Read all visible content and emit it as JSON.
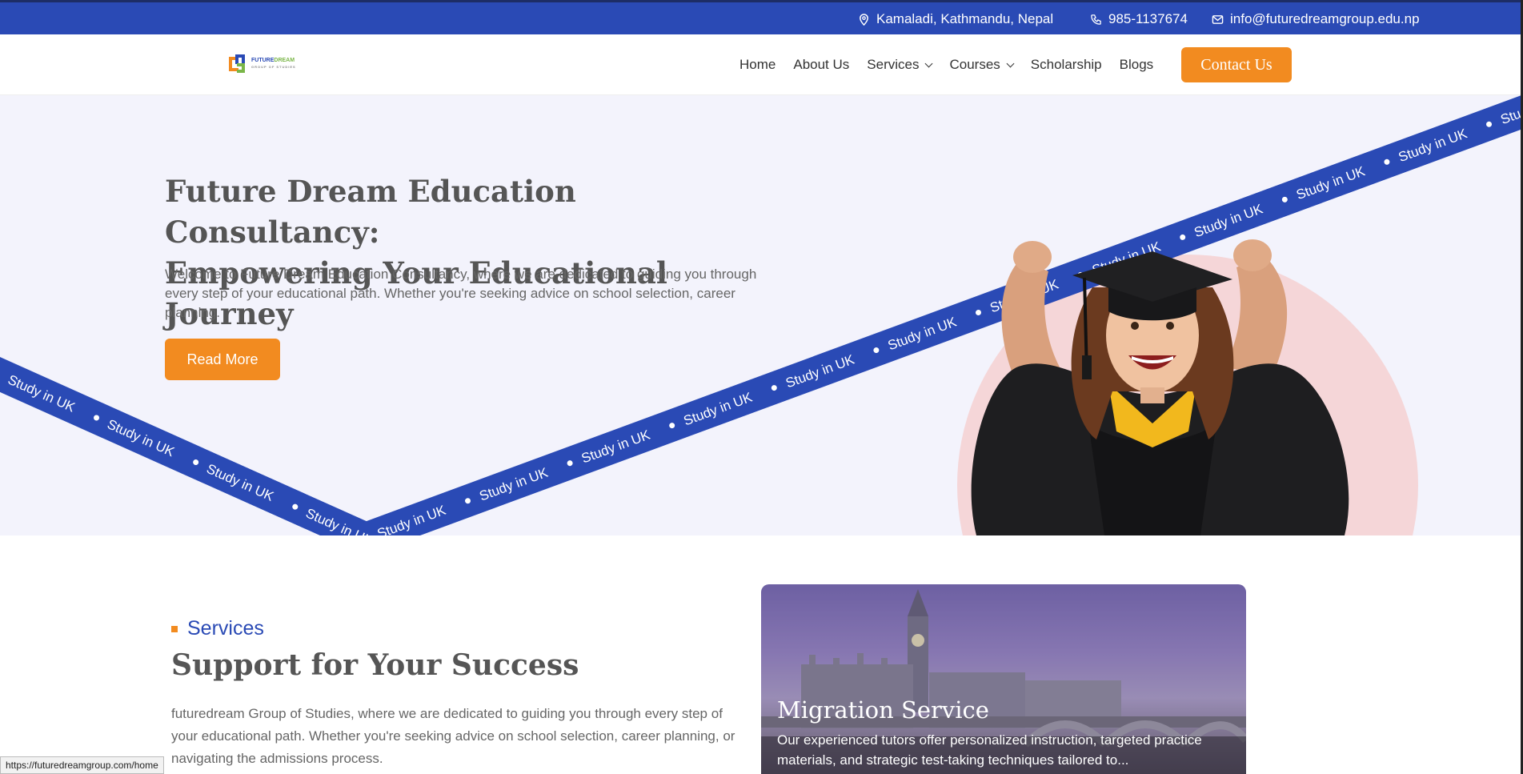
{
  "topbar": {
    "address": "Kamaladi, Kathmandu, Nepal",
    "phone": "985-1137674",
    "email": "info@futuredreamgroup.edu.np"
  },
  "logo": {
    "line1a": "FUTURE",
    "line1b": "DREAM",
    "line2": "GROUP OF STUDIES"
  },
  "nav": {
    "items": [
      "Home",
      "About Us",
      "Services",
      "Courses",
      "Scholarship",
      "Blogs"
    ],
    "contact_label": "Contact Us"
  },
  "hero": {
    "title_line1": "Future Dream Education Consultancy:",
    "title_line2": "Empowering Your Educational Journey",
    "description": "Welcome to Future Dream Education Consultancy, where we are dedicated to guiding you through every step of your educational path. Whether you're seeking advice on school selection, career planning.",
    "button_label": "Read More",
    "ribbon_text": "Study in UK"
  },
  "services": {
    "label": "Services",
    "title": "Support for Your Success",
    "description": "futuredream Group of Studies, where we are dedicated to guiding you through every step of your educational path. Whether you're seeking advice on school selection, career planning, or navigating the admissions process."
  },
  "card": {
    "title": "Migration Service",
    "description": "Our experienced tutors offer personalized instruction, targeted practice materials, and strategic test-taking techniques tailored to..."
  },
  "status_bar": {
    "url": "https://futuredreamgroup.com/home"
  },
  "colors": {
    "primary": "#2a4ab5",
    "accent": "#f28b20",
    "hero_bg": "#f3f3fc"
  }
}
